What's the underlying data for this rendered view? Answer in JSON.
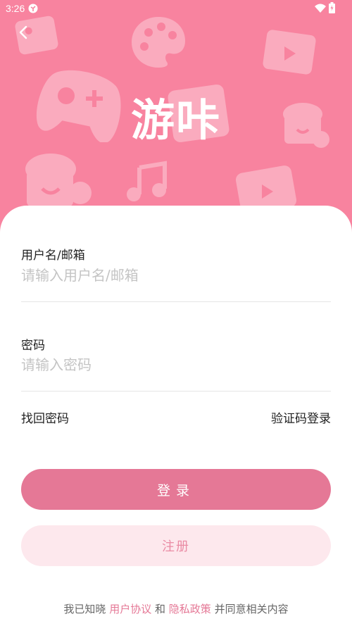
{
  "status_bar": {
    "time": "3:26",
    "icons": [
      "app-notification-icon",
      "wifi-icon",
      "battery-icon"
    ]
  },
  "header": {
    "back_icon": "chevron-left-icon",
    "app_title": "游咔",
    "background_color": "#f8839f",
    "decorations": [
      "image-card-icon",
      "palette-icon",
      "video-card-icon",
      "gamepad-icon",
      "coffee-cup-icon",
      "music-note-icon",
      "video-card-icon",
      "coffee-cup-icon"
    ]
  },
  "form": {
    "username": {
      "label": "用户名/邮箱",
      "placeholder": "请输入用户名/邮箱",
      "value": ""
    },
    "password": {
      "label": "密码",
      "placeholder": "请输入密码",
      "value": ""
    },
    "forgot_password": "找回密码",
    "sms_login": "验证码登录",
    "login_label": "登录",
    "register_label": "注册"
  },
  "agreement": {
    "prefix": "我已知晓",
    "user_agreement": "用户协议",
    "and": "和",
    "privacy_policy": "隐私政策",
    "suffix": "并同意相关内容"
  },
  "colors": {
    "accent": "#e57896",
    "header": "#f8839f",
    "register_bg": "#fde8ed"
  }
}
